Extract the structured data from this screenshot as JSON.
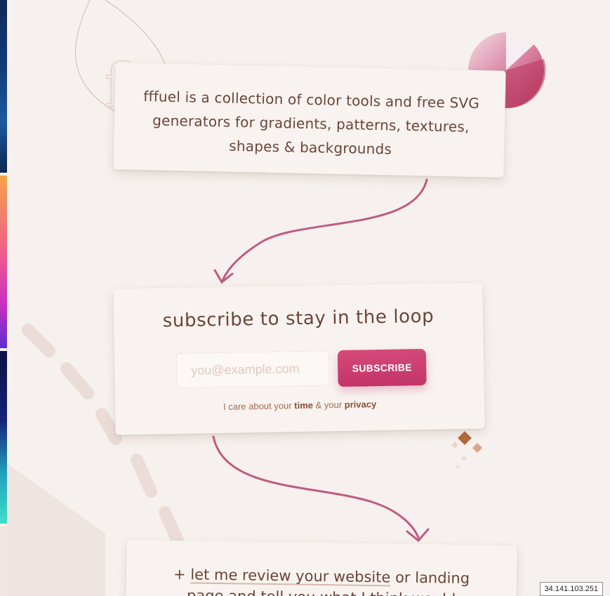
{
  "intro": {
    "text": "fffuel is a collection of color tools and free SVG generators for gradients, patterns, textures, shapes & backgrounds",
    "logo_letter": "f"
  },
  "subscribe": {
    "title": "subscribe to stay in the loop",
    "email_placeholder": "you@example.com",
    "button_label": "SUBSCRIBE",
    "note_prefix": "I care about your ",
    "note_time": "time",
    "note_middle": " & your ",
    "note_privacy": "privacy"
  },
  "review": {
    "prefix": "+ ",
    "link_text": "let me review your website",
    "suffix": " or landing",
    "line2": "page and tell you what I think would"
  },
  "ip_address": "34.141.103.251",
  "colors": {
    "accent": "#c23468",
    "text": "#6b4438",
    "arrow": "#c05a82",
    "background": "#f6f1ee"
  }
}
